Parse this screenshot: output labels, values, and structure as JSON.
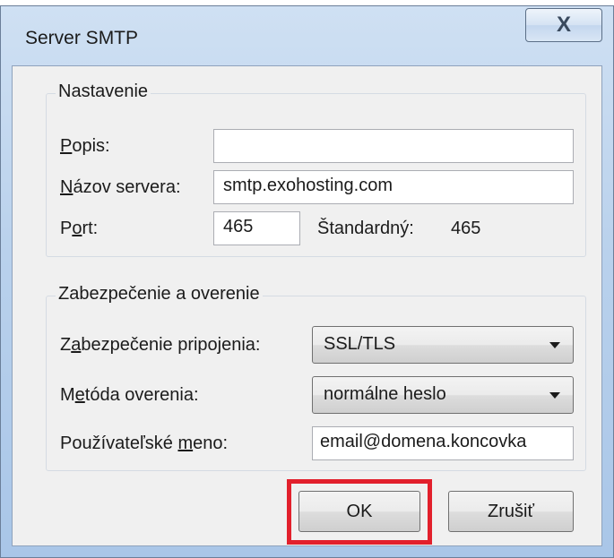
{
  "window": {
    "title": "Server SMTP",
    "close_glyph": "X"
  },
  "settings": {
    "legend": "Nastavenie",
    "description_label_accel": "P",
    "description_label_rest": "opis:",
    "description_value": "",
    "server_label_accel": "N",
    "server_label_rest": "ázov servera:",
    "server_value": "smtp.exohosting.com",
    "port_label_pre": "P",
    "port_label_accel": "o",
    "port_label_rest": "rt:",
    "port_value": "465",
    "default_label": "Štandardný:",
    "default_value": "465"
  },
  "security": {
    "legend": "Zabezpečenie a overenie",
    "connection_label_pre": "Z",
    "connection_label_accel": "a",
    "connection_label_rest": "bezpečenie pripojenia:",
    "connection_value": "SSL/TLS",
    "auth_label_pre": "M",
    "auth_label_accel": "e",
    "auth_label_rest": "tóda overenia:",
    "auth_value": "normálne heslo",
    "username_label_pre": "Používateľské ",
    "username_label_accel": "m",
    "username_label_rest": "eno:",
    "username_value": "email@domena.koncovka"
  },
  "buttons": {
    "ok": "OK",
    "cancel": "Zrušiť"
  },
  "colors": {
    "highlight": "#e2202c",
    "titlebar": "#b9d1ec"
  }
}
